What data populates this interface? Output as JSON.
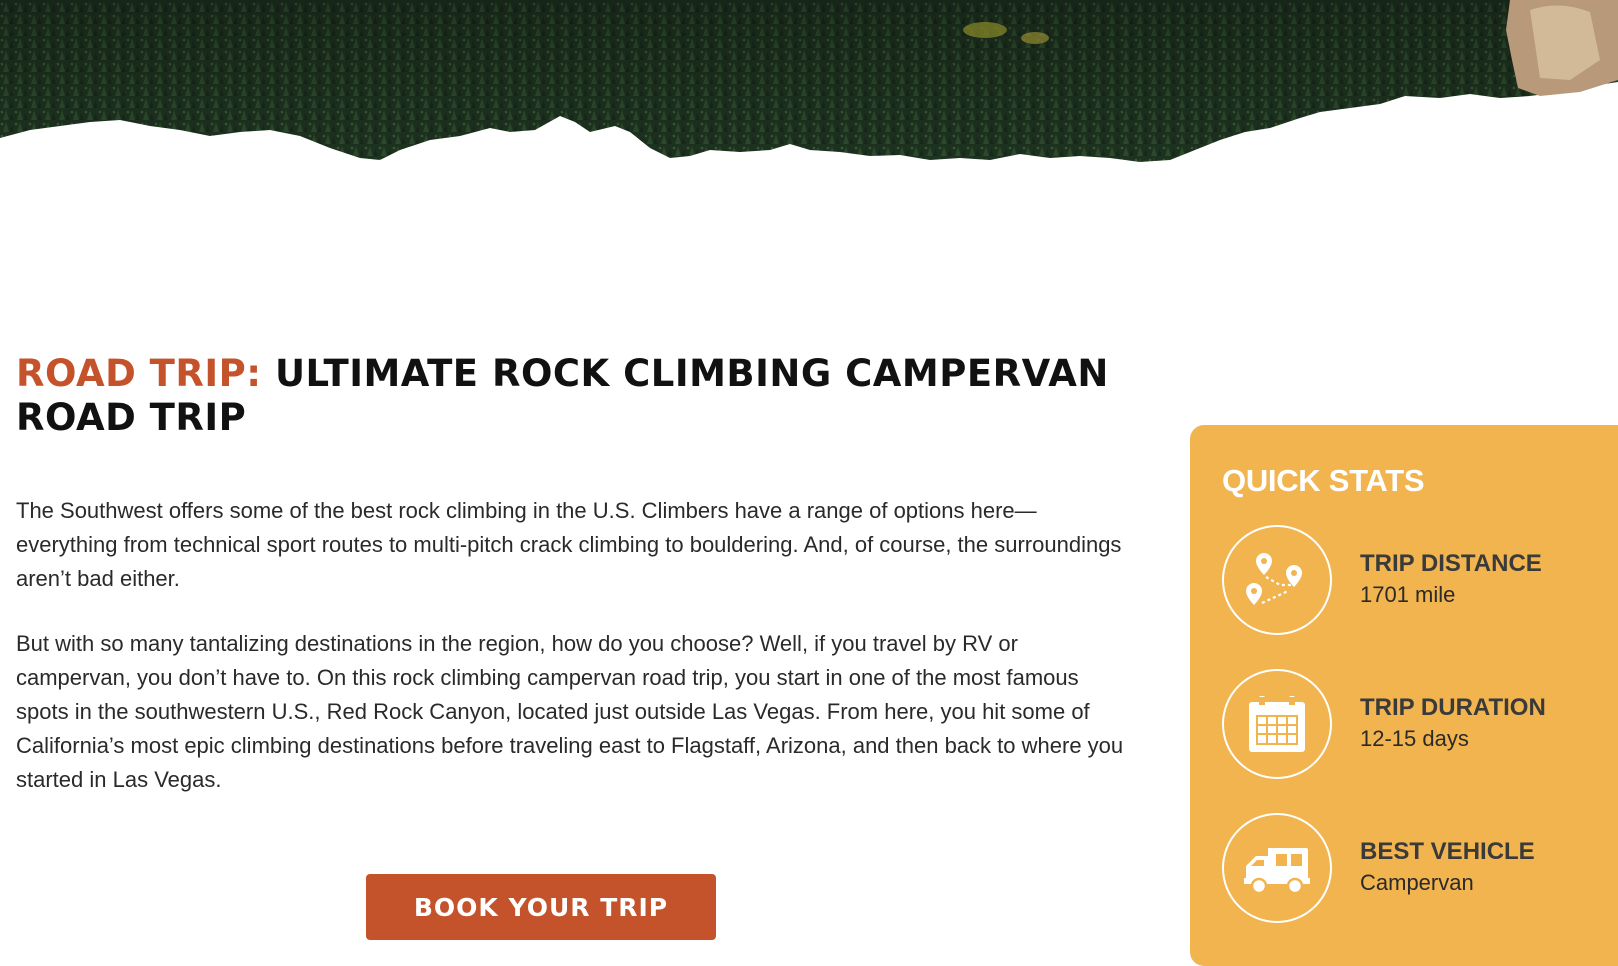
{
  "hero": {
    "description_icon": "forest-banner"
  },
  "article": {
    "title_prefix": "ROAD TRIP:",
    "title_main": "ULTIMATE ROCK CLIMBING CAMPERVAN ROAD TRIP",
    "paragraphs": [
      "The Southwest offers some of the best rock climbing in the U.S. Climbers have a range of options here—everything from technical sport routes to multi-pitch crack climbing to bouldering. And, of course, the surroundings aren’t bad either.",
      "But with so many tantalizing destinations in the region, how do you choose? Well, if you travel by RV or campervan, you don’t have to. On this rock climbing campervan road trip, you start in one of the most famous spots in the southwestern U.S., Red Rock Canyon, located just outside Las Vegas. From here, you hit some of California’s most epic climbing destinations before traveling east to Flagstaff, Arizona, and then back to where you started in Las Vegas."
    ],
    "cta_label": "BOOK YOUR TRIP"
  },
  "quick_stats": {
    "heading": "QUICK STATS",
    "items": [
      {
        "icon": "map-pins-icon",
        "label": "TRIP DISTANCE",
        "value": "1701 mile"
      },
      {
        "icon": "calendar-icon",
        "label": "TRIP DURATION",
        "value": "12-15 days"
      },
      {
        "icon": "campervan-icon",
        "label": "BEST VEHICLE",
        "value": "Campervan"
      }
    ]
  },
  "colors": {
    "accent": "#c4522a",
    "stats_panel": "#f1b44f",
    "forest": "#1f3320"
  }
}
